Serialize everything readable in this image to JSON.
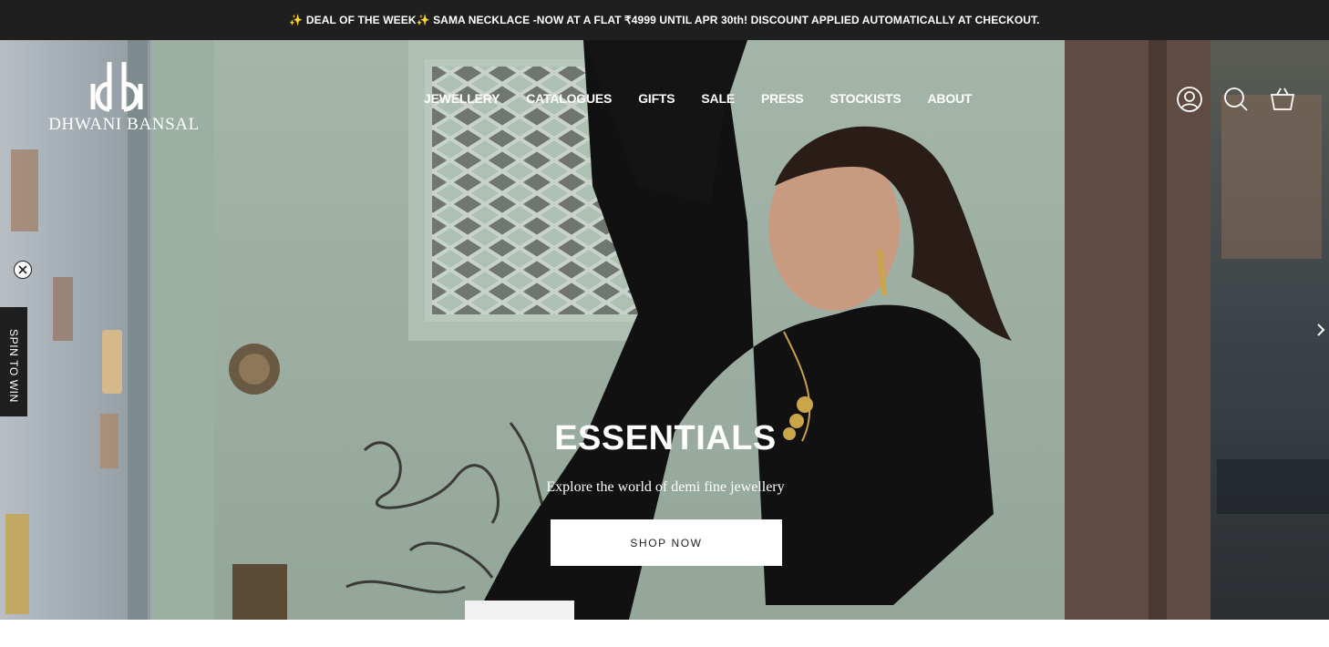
{
  "announcement": {
    "text": "✨ DEAL OF THE WEEK✨ SAMA NECKLACE -NOW AT A FLAT ₹4999 UNTIL APR 30th! DISCOUNT APPLIED AUTOMATICALLY AT CHECKOUT."
  },
  "brand": {
    "monogram": "db",
    "name": "DHWANI BANSAL"
  },
  "nav": {
    "items": [
      "JEWELLERY",
      "CATALOGUES",
      "GIFTS",
      "SALE",
      "PRESS",
      "STOCKISTS",
      "ABOUT"
    ]
  },
  "header_icons": [
    "account-icon",
    "search-icon",
    "cart-icon"
  ],
  "spin_widget": {
    "label": "SPIN TO WIN",
    "close_icon": "close-icon"
  },
  "hero": {
    "title": "ESSENTIALS",
    "subtitle": "Explore the world of demi fine jewellery",
    "cta_label": "SHOP NOW",
    "next_icon": "chevron-right-icon"
  },
  "colors": {
    "announcement_bg": "#1f1f1f",
    "text_on_dark": "#ffffff",
    "cta_bg": "#ffffff",
    "cta_text": "#222222"
  }
}
